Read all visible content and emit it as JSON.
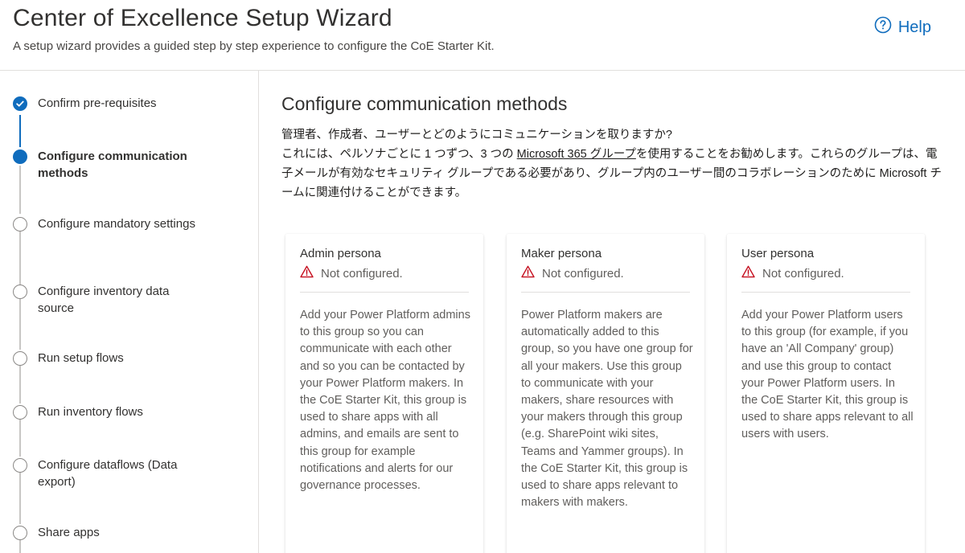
{
  "header": {
    "title": "Center of Excellence Setup Wizard",
    "subtitle": "A setup wizard provides a guided step by step experience to configure the CoE Starter Kit.",
    "help_label": "Help"
  },
  "steps": [
    {
      "label": "Confirm pre-requisites",
      "state": "done"
    },
    {
      "label": "Configure communication methods",
      "state": "current"
    },
    {
      "label": "Configure mandatory settings",
      "state": "pending"
    },
    {
      "label": "Configure inventory data source",
      "state": "pending"
    },
    {
      "label": "Run setup flows",
      "state": "pending"
    },
    {
      "label": "Run inventory flows",
      "state": "pending"
    },
    {
      "label": "Configure dataflows (Data export)",
      "state": "pending"
    },
    {
      "label": "Share apps",
      "state": "pending"
    }
  ],
  "main": {
    "title": "Configure communication methods",
    "question": "管理者、作成者、ユーザーとどのようにコミュニケーションを取りますか?",
    "intro_before_link": "これには、ペルソナごとに 1 つずつ、3 つの ",
    "intro_link": "Microsoft 365 グループ",
    "intro_after_link": "を使用することをお勧めします。これらのグループは、電子メールが有効なセキュリティ グループである必要があり、グループ内のユーザー間のコラボレーションのために Microsoft チームに関連付けることができます。"
  },
  "personas": [
    {
      "title": "Admin persona",
      "status": "Not configured.",
      "description": "Add your Power Platform admins to this group so you can communicate with each other and so you can be contacted by your Power Platform makers. In the CoE Starter Kit, this group is used to share apps with all admins, and emails are sent to this group for example notifications and alerts for our governance processes."
    },
    {
      "title": "Maker persona",
      "status": "Not configured.",
      "description": "Power Platform makers are automatically added to this group, so you have one group for all your makers. Use this group to communicate with your makers, share resources with your makers through this group (e.g. SharePoint wiki sites, Teams and Yammer groups). In the CoE Starter Kit, this group is used to share apps relevant to makers with makers."
    },
    {
      "title": "User persona",
      "status": "Not configured.",
      "description": "Add your Power Platform users to this group (for example, if you have an 'All Company' group) and use this group to contact your Power Platform users. In the CoE Starter Kit, this group is used to share apps relevant to all users with users."
    }
  ],
  "colors": {
    "accent": "#0f6cbd",
    "warning": "#c50f1f"
  },
  "icons": {
    "help": "help-circle-icon",
    "done": "checkmark-icon",
    "warning": "warning-icon"
  }
}
